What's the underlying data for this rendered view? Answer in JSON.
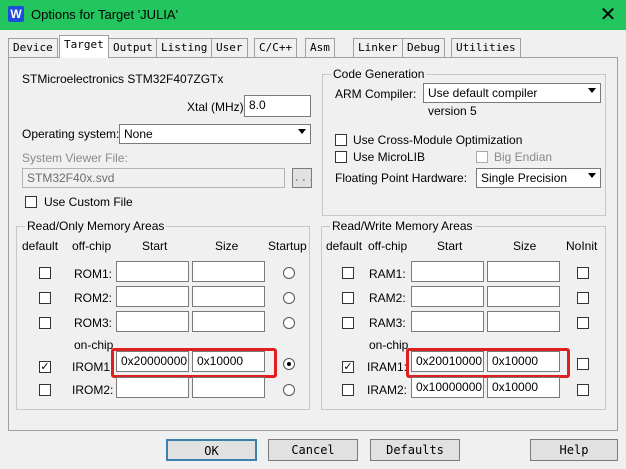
{
  "window": {
    "title": "Options for Target 'JULIA'",
    "icon": "uvision-icon"
  },
  "tabs": [
    "Device",
    "Target",
    "Output",
    "Listing",
    "User",
    "C/C++",
    "Asm",
    "Linker",
    "Debug",
    "Utilities"
  ],
  "target": {
    "device_name": "STMicroelectronics STM32F407ZGTx",
    "xtal_label": "Xtal (MHz):",
    "xtal_value": "8.0",
    "os_label": "Operating system:",
    "os_value": "None",
    "svd_label": "System Viewer File:",
    "svd_value": "STM32F40x.svd",
    "svd_browse": "...",
    "custom_file_label": "Use Custom File",
    "custom_file_checked": false
  },
  "code_generation": {
    "title": "Code Generation",
    "compiler_label": "ARM Compiler:",
    "compiler_value": "Use default compiler version 5",
    "cross_module_label": "Use Cross-Module Optimization",
    "cross_module_checked": false,
    "microlib_label": "Use MicroLIB",
    "microlib_checked": false,
    "big_endian_label": "Big Endian",
    "big_endian_checked": false,
    "fpu_label": "Floating Point Hardware:",
    "fpu_value": "Single Precision"
  },
  "ro_memory": {
    "title": "Read/Only Memory Areas",
    "headers": {
      "default": "default",
      "offchip": "off-chip",
      "start": "Start",
      "size": "Size",
      "startup": "Startup"
    },
    "onchip_label": "on-chip",
    "rows": [
      {
        "name": "ROM1:",
        "start": "",
        "size": "",
        "default": false,
        "startup": false
      },
      {
        "name": "ROM2:",
        "start": "",
        "size": "",
        "default": false,
        "startup": false
      },
      {
        "name": "ROM3:",
        "start": "",
        "size": "",
        "default": false,
        "startup": false
      },
      {
        "name": "IROM1:",
        "start": "0x20000000",
        "size": "0x10000",
        "default": true,
        "startup": true
      },
      {
        "name": "IROM2:",
        "start": "",
        "size": "",
        "default": false,
        "startup": false
      }
    ]
  },
  "rw_memory": {
    "title": "Read/Write Memory Areas",
    "headers": {
      "default": "default",
      "offchip": "off-chip",
      "start": "Start",
      "size": "Size",
      "noinit": "NoInit"
    },
    "onchip_label": "on-chip",
    "rows": [
      {
        "name": "RAM1:",
        "start": "",
        "size": "",
        "default": false,
        "noinit": false
      },
      {
        "name": "RAM2:",
        "start": "",
        "size": "",
        "default": false,
        "noinit": false
      },
      {
        "name": "RAM3:",
        "start": "",
        "size": "",
        "default": false,
        "noinit": false
      },
      {
        "name": "IRAM1:",
        "start": "0x20010000",
        "size": "0x10000",
        "default": true,
        "noinit": false
      },
      {
        "name": "IRAM2:",
        "start": "0x10000000",
        "size": "0x10000",
        "default": false,
        "noinit": false
      }
    ]
  },
  "buttons": {
    "ok": "OK",
    "cancel": "Cancel",
    "defaults": "Defaults",
    "help": "Help"
  },
  "colors": {
    "titlebar": "#22c55e",
    "highlight": "#e02020"
  }
}
